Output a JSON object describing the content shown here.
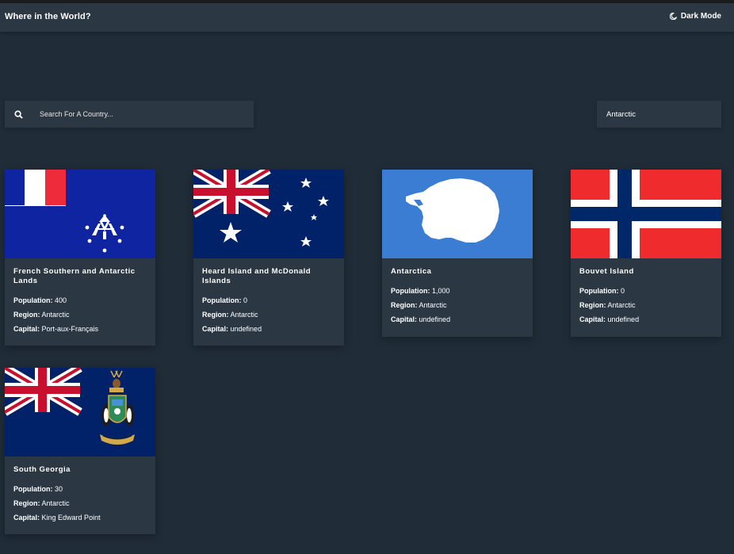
{
  "header": {
    "title": "Where in the World?",
    "mode_label": "Dark Mode"
  },
  "search": {
    "placeholder": "Search For A Country..."
  },
  "filter": {
    "selected": "Antarctic"
  },
  "labels": {
    "population": "Population:",
    "region": "Region:",
    "capital": "Capital:"
  },
  "countries": [
    {
      "name": "French Southern and Antarctic Lands",
      "population": "400",
      "region": "Antarctic",
      "capital": "Port-aux-Français"
    },
    {
      "name": "Heard Island and McDonald Islands",
      "population": "0",
      "region": "Antarctic",
      "capital": "undefined"
    },
    {
      "name": "Antarctica",
      "population": "1,000",
      "region": "Antarctic",
      "capital": "undefined"
    },
    {
      "name": "Bouvet Island",
      "population": "0",
      "region": "Antarctic",
      "capital": "undefined"
    },
    {
      "name": "South Georgia",
      "population": "30",
      "region": "Antarctic",
      "capital": "King Edward Point"
    }
  ],
  "colors": {
    "background": "#202c37",
    "element": "#2b3743",
    "text": "#ffffff"
  }
}
